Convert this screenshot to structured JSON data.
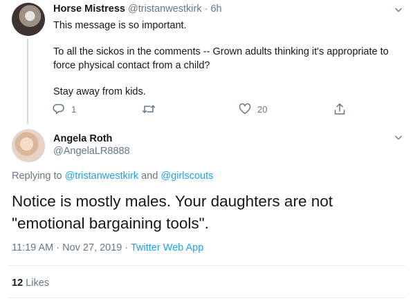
{
  "parent_tweet": {
    "author_name": "Horse Mistress",
    "author_meta": "@tristanwestkirk · 6h",
    "line1": "This message is so important.",
    "line2a": "To all the sickos in the comments -- Grown adults thinking it's appropriate to",
    "line2b": "force physical contact from a child?",
    "line3": "Stay away from kids.",
    "reply_count": "1",
    "like_count": "20"
  },
  "main_tweet": {
    "author_name": "Angela Roth",
    "author_handle": "@AngelaLR8888",
    "replying_prefix": "Replying to ",
    "replying_user1": "@tristanwestkirk",
    "replying_and": " and ",
    "replying_user2": "@girlscouts",
    "text_line1": "Notice is mostly males. Your daughters are not",
    "text_line2": "\"emotional bargaining tools\".",
    "timestamp": "11:19 AM · Nov 27, 2019 · ",
    "source": "Twitter Web App",
    "likes_count": "12",
    "likes_label": "Likes"
  },
  "colors": {
    "link": "#1da1f2",
    "muted": "#657786",
    "text": "#14171a"
  }
}
